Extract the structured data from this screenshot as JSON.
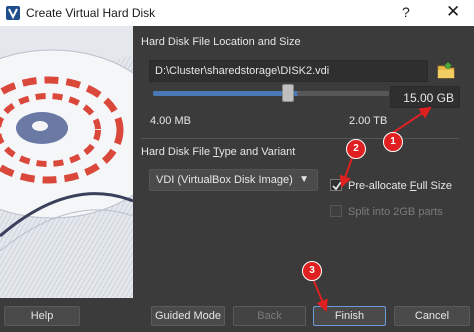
{
  "window": {
    "title": "Create Virtual Hard Disk",
    "help_glyph": "?",
    "close_glyph": "✕"
  },
  "location": {
    "section_title": "Hard Disk File Location and Size",
    "path_value": "D:\\Cluster\\sharedstorage\\DISK2.vdi",
    "size_value": "15.00 GB",
    "min_label": "4.00 MB",
    "max_label": "2.00 TB",
    "slider_fraction": 0.57
  },
  "type": {
    "section_title_a": "Hard Disk File ",
    "section_title_u": "T",
    "section_title_b": "ype and Variant",
    "format_selected": "VDI (VirtualBox Disk Image)",
    "preallocate_a": "Pre-allocate ",
    "preallocate_u": "F",
    "preallocate_b": "ull Size",
    "preallocate_checked": true,
    "split_label": "Split into 2GB parts",
    "split_checked": false
  },
  "buttons": {
    "help": "Help",
    "guided": "Guided Mode",
    "back": "Back",
    "finish": "Finish",
    "cancel": "Cancel"
  },
  "annotations": {
    "one": "1",
    "two": "2",
    "three": "3",
    "color": "#e02020"
  }
}
